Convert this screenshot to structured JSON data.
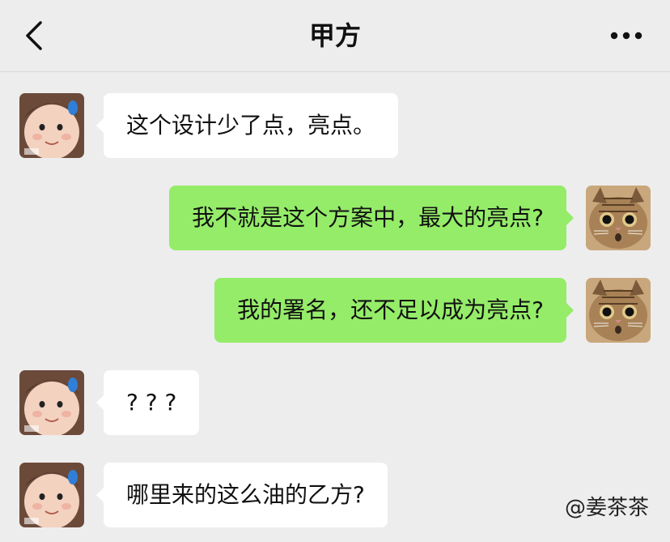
{
  "header": {
    "title": "甲方",
    "back_icon": "chevron-left-icon",
    "more_icon": "more-dots-icon"
  },
  "colors": {
    "background": "#ededed",
    "incoming_bubble": "#ffffff",
    "outgoing_bubble": "#95ec69"
  },
  "messages": [
    {
      "side": "in",
      "sender": "甲方",
      "text": "这个设计少了点，亮点。"
    },
    {
      "side": "out",
      "sender": "self",
      "text": "我不就是这个方案中，最大的亮点?"
    },
    {
      "side": "out",
      "sender": "self",
      "text": "我的署名，还不足以成为亮点?"
    },
    {
      "side": "in",
      "sender": "甲方",
      "text": "? ? ?"
    },
    {
      "side": "in",
      "sender": "甲方",
      "text": "哪里来的这么油的乙方?"
    }
  ],
  "watermark": "@姜茶茶"
}
